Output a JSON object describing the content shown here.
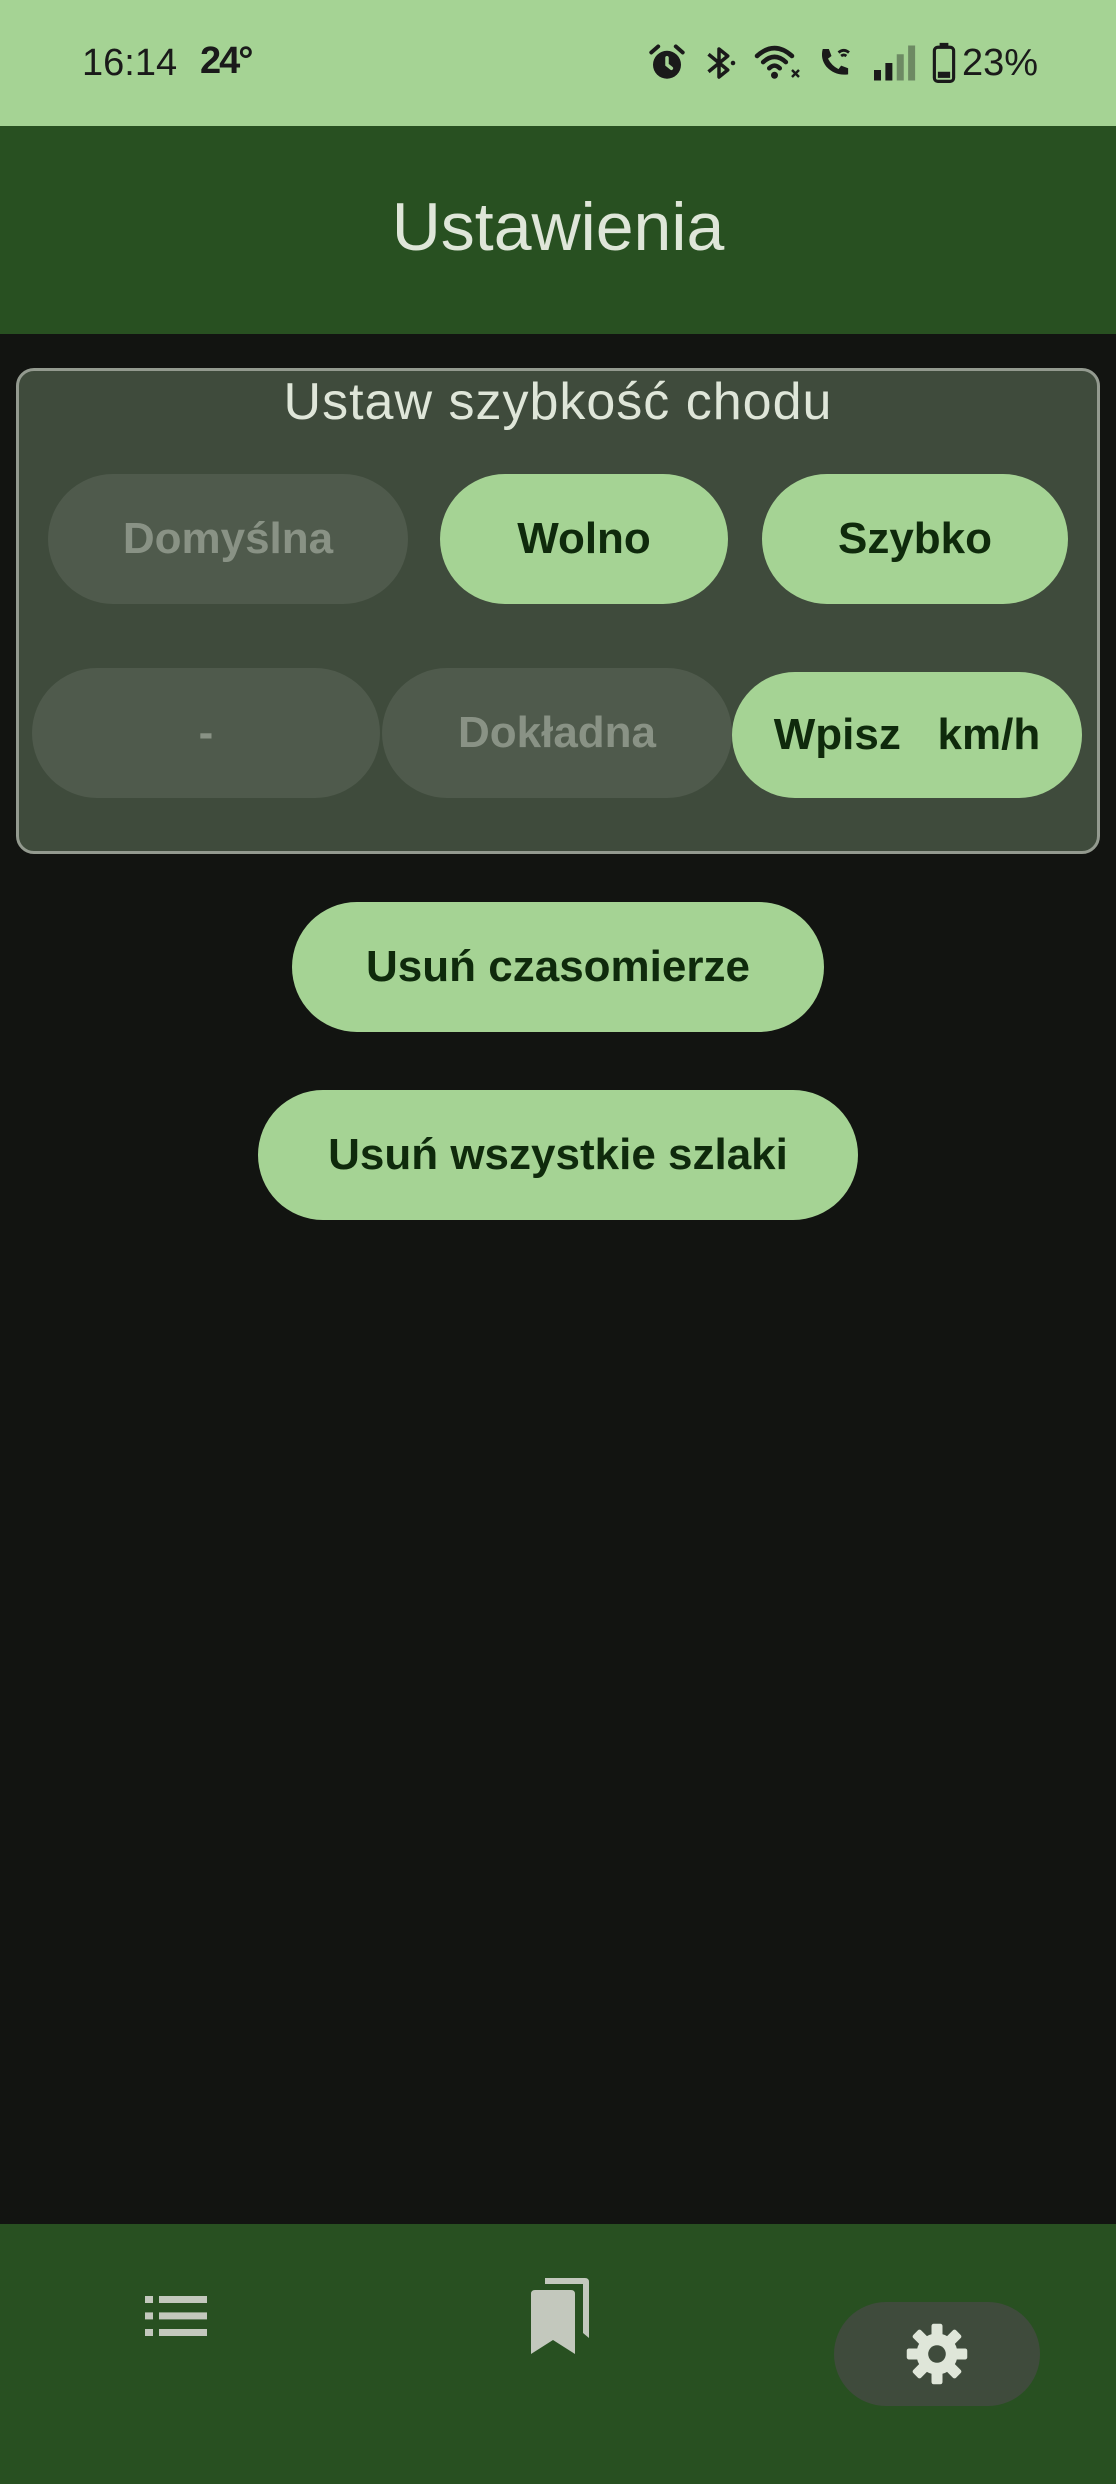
{
  "status_bar": {
    "time": "16:14",
    "temperature": "24°",
    "battery": "23%",
    "icons": [
      "alarm-icon",
      "bluetooth-icon",
      "wifi-icon",
      "wifi-call-icon",
      "signal-icon",
      "battery-icon"
    ]
  },
  "app_bar": {
    "title": "Ustawienia"
  },
  "speed_card": {
    "title": "Ustaw szybkość chodu",
    "row1": [
      {
        "label": "Domyślna",
        "state": "disabled"
      },
      {
        "label": "Wolno",
        "state": "enabled"
      },
      {
        "label": "Szybko",
        "state": "enabled"
      }
    ],
    "row2": [
      {
        "label": "-",
        "state": "disabled"
      },
      {
        "label": "Dokładna",
        "state": "disabled"
      },
      {
        "label": "Wpisz   km/h",
        "state": "enabled"
      }
    ]
  },
  "actions": {
    "clear_timers": "Usuń czasomierze",
    "delete_all_trails": "Usuń wszystkie szlaki"
  },
  "bottom_nav": {
    "items": [
      {
        "icon": "list-icon",
        "active": false
      },
      {
        "icon": "bookmarks-icon",
        "active": false
      },
      {
        "icon": "settings-gear-icon",
        "active": true
      }
    ]
  },
  "colors": {
    "status_bar": "#a5d394",
    "app_bar": "#285021",
    "background": "#121411",
    "button_active": "#a5d394",
    "button_disabled": "#4f5a4c",
    "card": "#3f4b3c"
  }
}
